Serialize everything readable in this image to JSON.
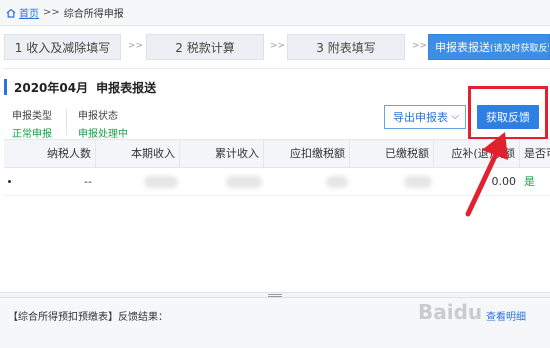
{
  "breadcrumb": {
    "home": "首页",
    "separator": ">>",
    "current": "综合所得申报"
  },
  "steps": [
    {
      "label": "1 收入及减除填写"
    },
    {
      "label": "2 税款计算"
    },
    {
      "label": "3 附表填写"
    },
    {
      "label": "申报表报送",
      "note": "(请及时获取反馈"
    }
  ],
  "step_arrow": ">>",
  "panel": {
    "period": "2020年04月",
    "title": "申报表报送",
    "declare_type_label": "申报类型",
    "declare_type_value": "正常申报",
    "declare_status_label": "申报状态",
    "declare_status_value": "申报处理中",
    "export_label": "导出申报表",
    "export_chevron": "⌵",
    "fetch_label": "获取反馈"
  },
  "table": {
    "headers": [
      "纳税人数",
      "本期收入",
      "累计收入",
      "应扣缴税额",
      "已缴税额",
      "应补(退)税额",
      "是否可"
    ],
    "row": {
      "taxpayers": "--",
      "refund": "0.00",
      "status": "是"
    }
  },
  "result": {
    "label": "【综合所得预扣预缴表】反馈结果：",
    "link": "查看明细"
  },
  "watermark": "Baidu",
  "colors": {
    "accent": "#2f7fe3",
    "highlight": "#e1212d",
    "success": "#17a24a"
  }
}
